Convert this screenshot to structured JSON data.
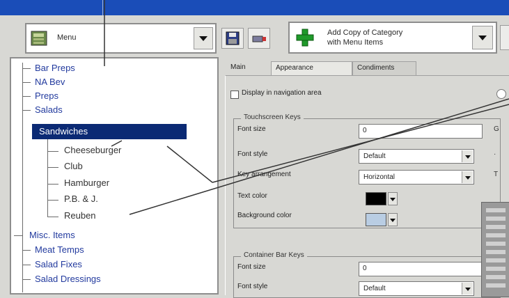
{
  "toolbar": {
    "left_combo_label": "Menu",
    "add_button_line1": "Add Copy of Category",
    "add_button_line2": "with Menu Items"
  },
  "tree": {
    "items": [
      {
        "label": "Bar Preps"
      },
      {
        "label": "NA Bev"
      },
      {
        "label": "Preps"
      },
      {
        "label": "Salads"
      },
      {
        "label": "Sandwiches",
        "selected": true
      },
      {
        "label": "Cheeseburger"
      },
      {
        "label": "Club"
      },
      {
        "label": "Hamburger"
      },
      {
        "label": "P.B. & J."
      },
      {
        "label": "Reuben"
      },
      {
        "label": "Misc. Items"
      },
      {
        "label": "Meat Temps"
      },
      {
        "label": "Salad Fixes"
      },
      {
        "label": "Salad Dressings"
      }
    ]
  },
  "tabs": [
    "Main",
    "Appearance",
    "Condiments"
  ],
  "appearance": {
    "display_checkbox_label": "Display in navigation area",
    "touchscreen_group_title": "Touchscreen Keys",
    "font_size_label": "Font size",
    "font_size_value": "0",
    "font_style_label": "Font style",
    "font_style_value": "Default",
    "key_arrangement_label": "Key arrangement",
    "key_arrangement_value": "Horizontal",
    "text_color_label": "Text color",
    "text_color_hex": "#000000",
    "bg_color_label": "Background color",
    "bg_color_hex": "#b9cde3",
    "container_group_title": "Container Bar Keys",
    "cb_font_size_label": "Font size",
    "cb_font_size_value": "0",
    "cb_font_style_label": "Font style",
    "cb_font_style_value": "Default"
  },
  "colors": {
    "title_bar": "#1a4db8",
    "selection": "#0b2a74",
    "tree_text": "#223a9e"
  }
}
